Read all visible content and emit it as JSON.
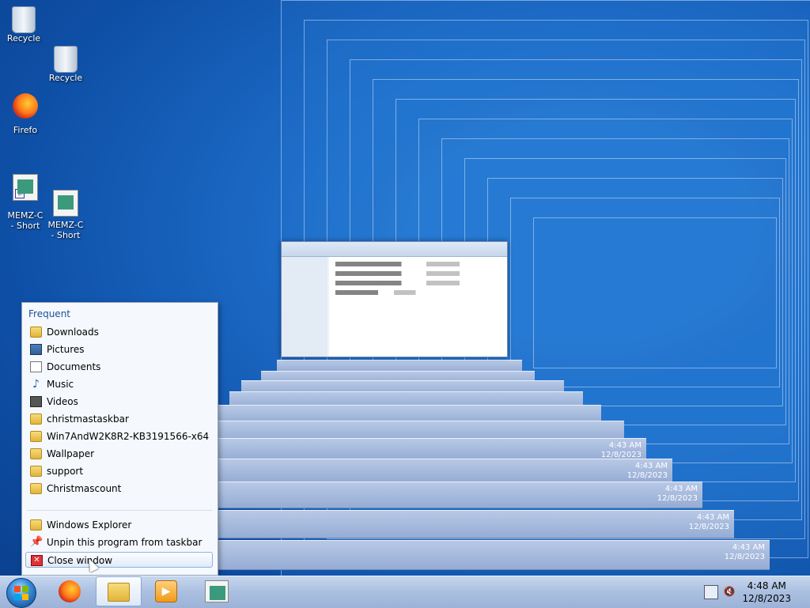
{
  "desktop": {
    "icons": {
      "recycle_label": "Recycle",
      "firefox_label": "Firefo",
      "memz_label_line1": "MEMZ-C",
      "memz_label_line2": "- Short"
    },
    "tunnel_clock_time": "4:48 AM",
    "tunnel_clock_date": "12/8/2023",
    "tunnel_clock_time_alt": "4:43 AM"
  },
  "jump_list": {
    "header": "Frequent",
    "items": [
      {
        "label": "Downloads",
        "icon": "downloads-folder-icon"
      },
      {
        "label": "Pictures",
        "icon": "pictures-icon"
      },
      {
        "label": "Documents",
        "icon": "documents-icon"
      },
      {
        "label": "Music",
        "icon": "music-icon"
      },
      {
        "label": "Videos",
        "icon": "videos-icon"
      },
      {
        "label": "christmastaskbar",
        "icon": "folder-icon"
      },
      {
        "label": "Win7AndW2K8R2-KB3191566-x64",
        "icon": "folder-icon"
      },
      {
        "label": "Wallpaper",
        "icon": "folder-icon"
      },
      {
        "label": "support",
        "icon": "folder-icon"
      },
      {
        "label": "Christmascount",
        "icon": "folder-icon"
      }
    ],
    "tasks": [
      {
        "label": "Windows Explorer",
        "icon": "windows-explorer-icon"
      },
      {
        "label": "Unpin this program from taskbar",
        "icon": "unpin-icon"
      },
      {
        "label": "Close window",
        "icon": "close-window-icon"
      }
    ]
  },
  "taskbar": {
    "clock_time": "4:48 AM",
    "clock_date": "12/8/2023"
  }
}
